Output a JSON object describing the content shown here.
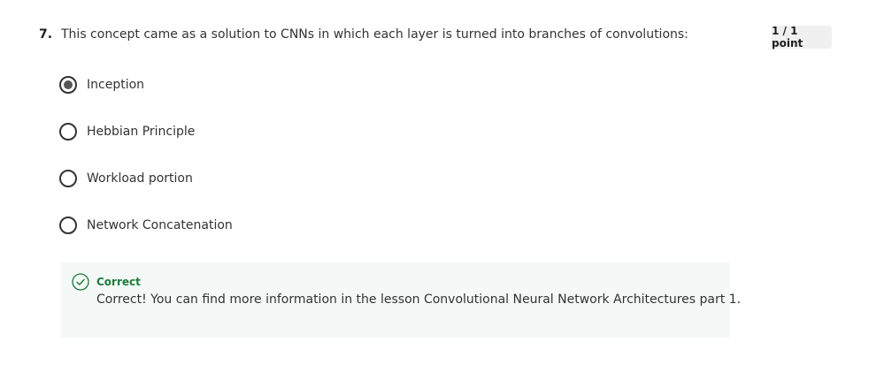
{
  "question": {
    "number": "7.",
    "text": "This concept came as a solution to CNNs in which each layer is turned into branches of convolutions:",
    "points": "1 / 1 point"
  },
  "options": [
    {
      "label": "Inception",
      "selected": true
    },
    {
      "label": "Hebbian Principle",
      "selected": false
    },
    {
      "label": "Workload portion",
      "selected": false
    },
    {
      "label": "Network Concatenation",
      "selected": false
    }
  ],
  "feedback": {
    "status": "Correct",
    "message": "Correct! You can find more information in the lesson Convolutional Neural Network Architectures part 1.",
    "icon": "check-circle-icon",
    "color": "#1f7a3d"
  },
  "colors": {
    "selected_radio": "#555555",
    "feedback_background": "#f4f8f6",
    "badge_background": "#f0f0f0"
  }
}
